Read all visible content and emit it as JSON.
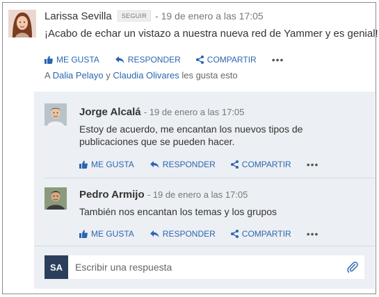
{
  "post": {
    "author": "Larissa Sevilla",
    "follow_label": "SEGUIR",
    "time": "- 19 de enero a las 17:05",
    "body": "¡Acabo de echar un vistazo a nuestra nueva red de Yammer y es genial!",
    "actions": {
      "like": "ME GUSTA",
      "reply": "RESPONDER",
      "share": "COMPARTIR",
      "more": "•••"
    },
    "likes": {
      "prefix": "A",
      "user1": "Dalia Pelayo",
      "connector": "y",
      "user2": "Claudia Olivares",
      "suffix": "les gusta esto"
    }
  },
  "replies": [
    {
      "author": "Jorge Alcalá",
      "time": "- 19 de enero a las 17:05",
      "body": "Estoy de acuerdo, me encantan los nuevos tipos de publicaciones que se pueden hacer.",
      "actions": {
        "like": "ME GUSTA",
        "reply": "RESPONDER",
        "share": "COMPARTIR",
        "more": "•••"
      }
    },
    {
      "author": "Pedro Armijo",
      "time": "- 19 de enero a las 17:05",
      "body": "También nos encantan los temas y los grupos",
      "actions": {
        "like": "ME GUSTA",
        "reply": "RESPONDER",
        "share": "COMPARTIR",
        "more": "•••"
      }
    }
  ],
  "composer": {
    "initials": "SA",
    "placeholder": "Escribir una respuesta",
    "attach_icon": "paperclip-icon"
  },
  "colors": {
    "link": "#2a66b0",
    "thread_bg": "#eceff3",
    "avatar_sa": "#2b3e5c"
  }
}
